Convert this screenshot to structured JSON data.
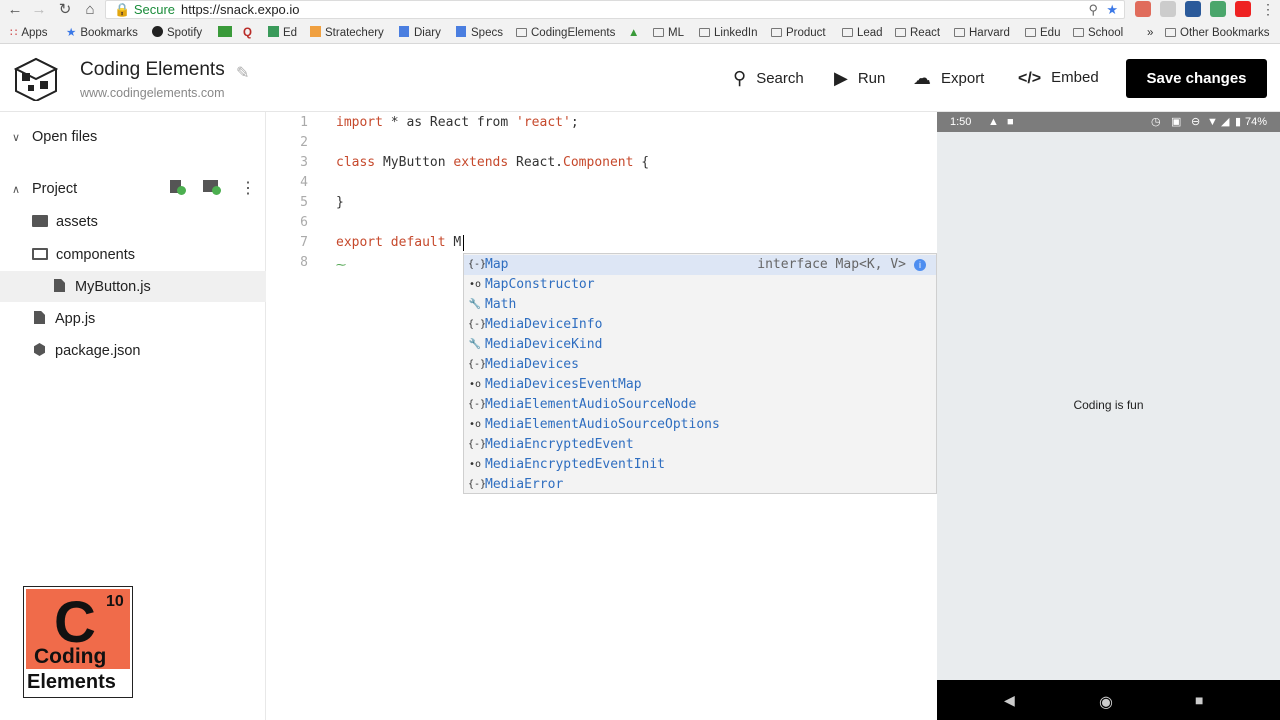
{
  "browser": {
    "secure_label": "Secure",
    "url": "https://snack.expo.io",
    "bookmarks": [
      "Apps",
      "Bookmarks",
      "Spotify",
      "Ed",
      "Stratechery",
      "Diary",
      "Specs",
      "CodingElements",
      "ML",
      "LinkedIn",
      "Product",
      "Lead",
      "React",
      "Harvard",
      "Edu",
      "School",
      "Other Bookmarks"
    ],
    "overflow_label": "»"
  },
  "header": {
    "app_name": "Coding Elements",
    "app_url": "www.codingelements.com",
    "search_label": "Search",
    "run_label": "Run",
    "export_label": "Export",
    "embed_label": "Embed",
    "save_label": "Save changes"
  },
  "sidebar": {
    "open_files": "Open files",
    "project": "Project",
    "items": [
      "assets",
      "components",
      "MyButton.js",
      "App.js",
      "package.json"
    ]
  },
  "editor": {
    "line_numbers": [
      "1",
      "2",
      "3",
      "4",
      "5",
      "6",
      "7",
      "8"
    ],
    "lines": {
      "l1_kw": "import",
      "l1_mid": " * as React from ",
      "l1_str": "'react'",
      "l1_end": ";",
      "l3_kw": "class",
      "l3_mid": " MyButton ",
      "l3_kw2": "extends",
      "l3_mid2": " React.",
      "l3_cls": "Component",
      "l3_end": " {",
      "l5": "}",
      "l7_kw": "export",
      "l7_kw2": "default",
      "l7_end": " M"
    },
    "autocomplete": {
      "detail": "interface Map<K, V>",
      "items": [
        "Map",
        "MapConstructor",
        "Math",
        "MediaDeviceInfo",
        "MediaDeviceKind",
        "MediaDevices",
        "MediaDevicesEventMap",
        "MediaElementAudioSourceNode",
        "MediaElementAudioSourceOptions",
        "MediaEncryptedEvent",
        "MediaEncryptedEventInit",
        "MediaError"
      ],
      "icons": [
        "{-}",
        "•o",
        "wrench",
        "{-}",
        "wrench",
        "{-}",
        "•o",
        "{-}",
        "•o",
        "{-}",
        "•o",
        "{-}"
      ]
    }
  },
  "phone": {
    "time": "1:50",
    "battery": "74%",
    "content_text": "Coding is fun"
  },
  "badge": {
    "letter": "C",
    "number": "10",
    "word1": "Coding",
    "word2": "Elements"
  }
}
